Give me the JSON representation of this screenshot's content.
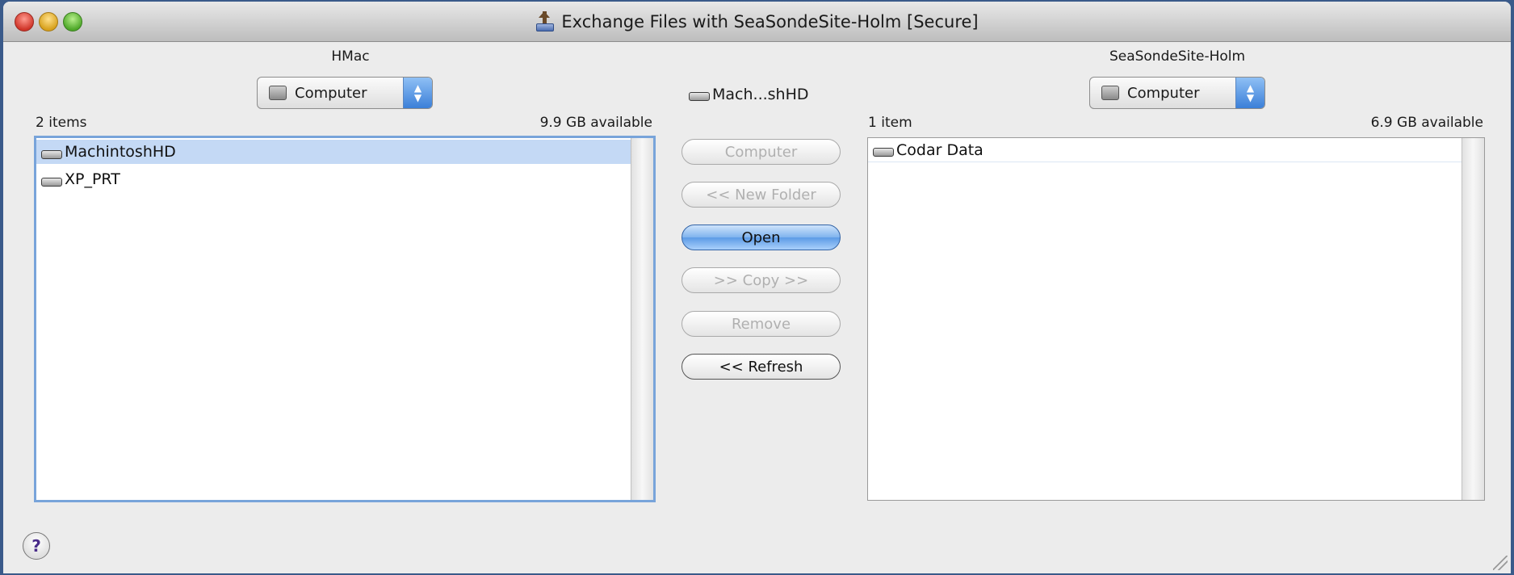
{
  "window": {
    "title": "Exchange Files with SeaSondeSite-Holm [Secure]"
  },
  "left_pane": {
    "host_label": "HMac",
    "location_popup": "Computer",
    "item_count": "2 items",
    "available": "9.9 GB available",
    "items": [
      {
        "name": "MachintoshHD",
        "selected": true,
        "icon": "hard-drive-icon"
      },
      {
        "name": "XP_PRT",
        "selected": false,
        "icon": "hard-drive-icon"
      }
    ]
  },
  "right_pane": {
    "host_label": "SeaSondeSite-Holm",
    "location_popup": "Computer",
    "item_count": "1 item",
    "available": "6.9 GB available",
    "items": [
      {
        "name": "Codar Data",
        "selected": false,
        "icon": "hard-drive-icon"
      }
    ]
  },
  "middle": {
    "current_path": "Mach...shHD",
    "buttons": {
      "computer": "Computer",
      "new_folder": "<< New Folder",
      "open": "Open",
      "copy": ">> Copy >>",
      "remove": "Remove",
      "refresh": "<< Refresh"
    },
    "enabled": {
      "computer": false,
      "new_folder": false,
      "open": true,
      "copy": false,
      "remove": false,
      "refresh": true
    }
  },
  "help_button": "?",
  "colors": {
    "selection": "#c4d9f5",
    "focus_ring": "#78a4da",
    "default_button": "#5c9be6"
  }
}
